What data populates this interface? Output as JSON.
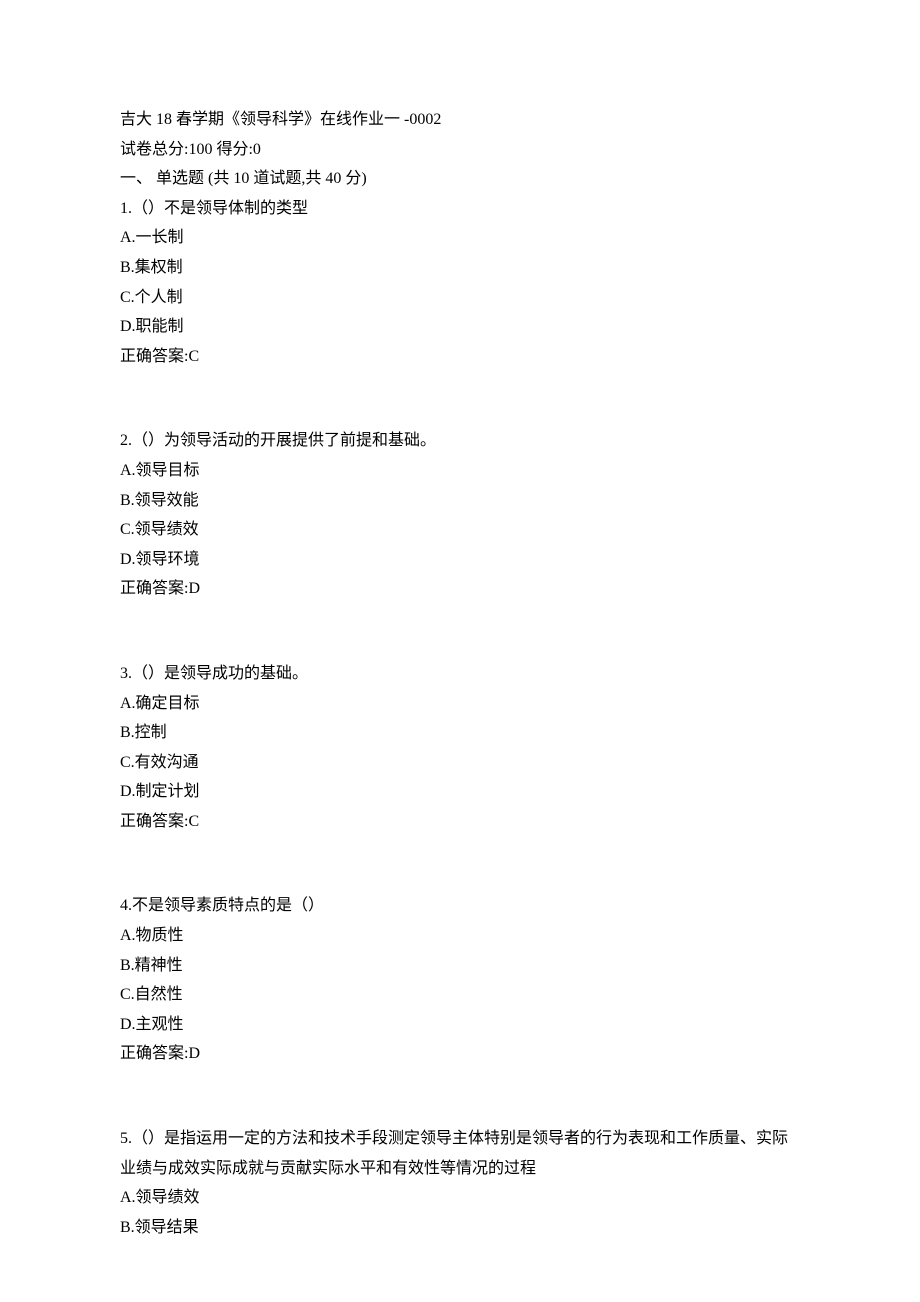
{
  "header": {
    "title": "吉大 18 春学期《领导科学》在线作业一  -0002",
    "score_line": "试卷总分:100       得分:0",
    "section_title": "一、  单选题 (共 10 道试题,共 40 分)"
  },
  "questions": [
    {
      "stem": "1.（）不是领导体制的类型",
      "options": [
        "A.一长制",
        "B.集权制",
        "C.个人制",
        "D.职能制"
      ],
      "answer": "正确答案:C"
    },
    {
      "stem": "2.（）为领导活动的开展提供了前提和基础。",
      "options": [
        "A.领导目标",
        "B.领导效能",
        "C.领导绩效",
        "D.领导环境"
      ],
      "answer": "正确答案:D"
    },
    {
      "stem": "3.（）是领导成功的基础。",
      "options": [
        "A.确定目标",
        "B.控制",
        "C.有效沟通",
        "D.制定计划"
      ],
      "answer": "正确答案:C"
    },
    {
      "stem": "4.不是领导素质特点的是（）",
      "options": [
        "A.物质性",
        "B.精神性",
        "C.自然性",
        "D.主观性"
      ],
      "answer": "正确答案:D"
    },
    {
      "stem": "5.（）是指运用一定的方法和技术手段测定领导主体特别是领导者的行为表现和工作质量、实际业绩与成效实际成就与贡献实际水平和有效性等情况的过程",
      "options": [
        "A.领导绩效",
        "B.领导结果"
      ],
      "answer": ""
    }
  ]
}
